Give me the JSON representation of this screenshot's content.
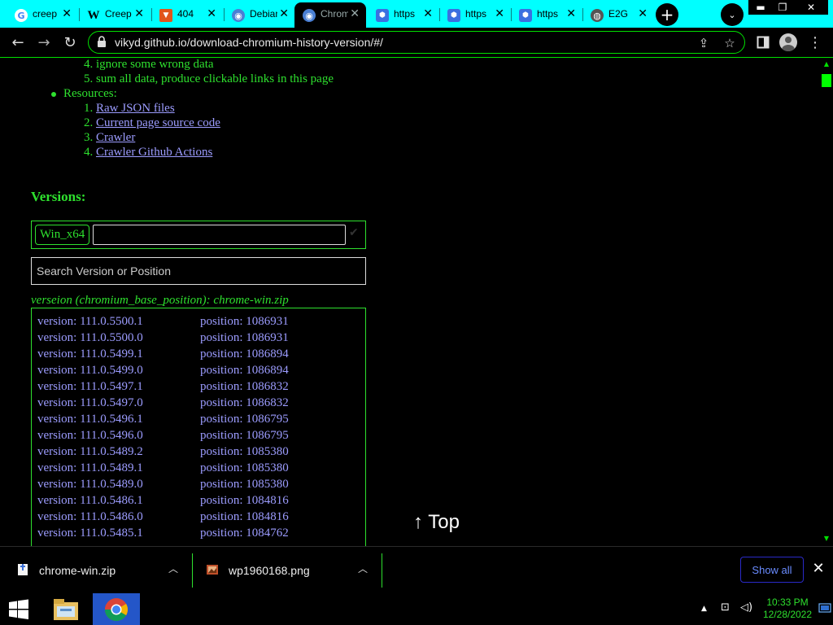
{
  "tabs": [
    {
      "title": "creep",
      "icon": "google-icon",
      "active": false
    },
    {
      "title": "Creep",
      "icon": "wikipedia-icon",
      "active": false
    },
    {
      "title": "404",
      "icon": "shield-icon",
      "active": false
    },
    {
      "title": "Debian",
      "icon": "chromium-icon",
      "active": false
    },
    {
      "title": "Chromium",
      "icon": "chromium-icon",
      "active": true
    },
    {
      "title": "https",
      "icon": "hexagon-icon",
      "active": false
    },
    {
      "title": "https",
      "icon": "hexagon-icon",
      "active": false
    },
    {
      "title": "https",
      "icon": "hexagon-icon",
      "active": false
    },
    {
      "title": "E2G",
      "icon": "globe-icon",
      "active": false
    }
  ],
  "toolbar": {
    "url": "vikyd.github.io/download-chromium-history-version/#/"
  },
  "page": {
    "steps_tail": [
      {
        "num": "4.",
        "text": "ignore some wrong data"
      },
      {
        "num": "5.",
        "text": "sum all data, produce clickable links in this page"
      }
    ],
    "resources_label": "Resources:",
    "resources": [
      {
        "num": "1.",
        "text": "Raw JSON files"
      },
      {
        "num": "2.",
        "text": "Current page source code"
      },
      {
        "num": "3.",
        "text": "Crawler"
      },
      {
        "num": "4.",
        "text": "Crawler Github Actions"
      }
    ],
    "versions_heading": "Versions:",
    "platform_selected": "Win_x64",
    "search_placeholder": "Search Version or Position",
    "list_caption": "verseion (chromium_base_position): chrome-win.zip",
    "versions": [
      {
        "version": "version: 111.0.5500.1",
        "position": "position: 1086931"
      },
      {
        "version": "version: 111.0.5500.0",
        "position": "position: 1086931"
      },
      {
        "version": "version: 111.0.5499.1",
        "position": "position: 1086894"
      },
      {
        "version": "version: 111.0.5499.0",
        "position": "position: 1086894"
      },
      {
        "version": "version: 111.0.5497.1",
        "position": "position: 1086832"
      },
      {
        "version": "version: 111.0.5497.0",
        "position": "position: 1086832"
      },
      {
        "version": "version: 111.0.5496.1",
        "position": "position: 1086795"
      },
      {
        "version": "version: 111.0.5496.0",
        "position": "position: 1086795"
      },
      {
        "version": "version: 111.0.5489.2",
        "position": "position: 1085380"
      },
      {
        "version": "version: 111.0.5489.1",
        "position": "position: 1085380"
      },
      {
        "version": "version: 111.0.5489.0",
        "position": "position: 1085380"
      },
      {
        "version": "version: 111.0.5486.1",
        "position": "position: 1084816"
      },
      {
        "version": "version: 111.0.5486.0",
        "position": "position: 1084816"
      },
      {
        "version": "version: 111.0.5485.1",
        "position": "position: 1084762"
      }
    ],
    "top_link": "↑ Top"
  },
  "downloads": [
    {
      "name": "chrome-win.zip",
      "icon": "zip-file-icon"
    },
    {
      "name": "wp1960168.png",
      "icon": "image-file-icon"
    }
  ],
  "shelf": {
    "show_all": "Show all"
  },
  "clock": {
    "time": "10:33 PM",
    "date": "12/28/2022"
  },
  "colors": {
    "accent": "#2ee02e",
    "link": "#9c9cff",
    "tabstrip": "#00ffff"
  }
}
